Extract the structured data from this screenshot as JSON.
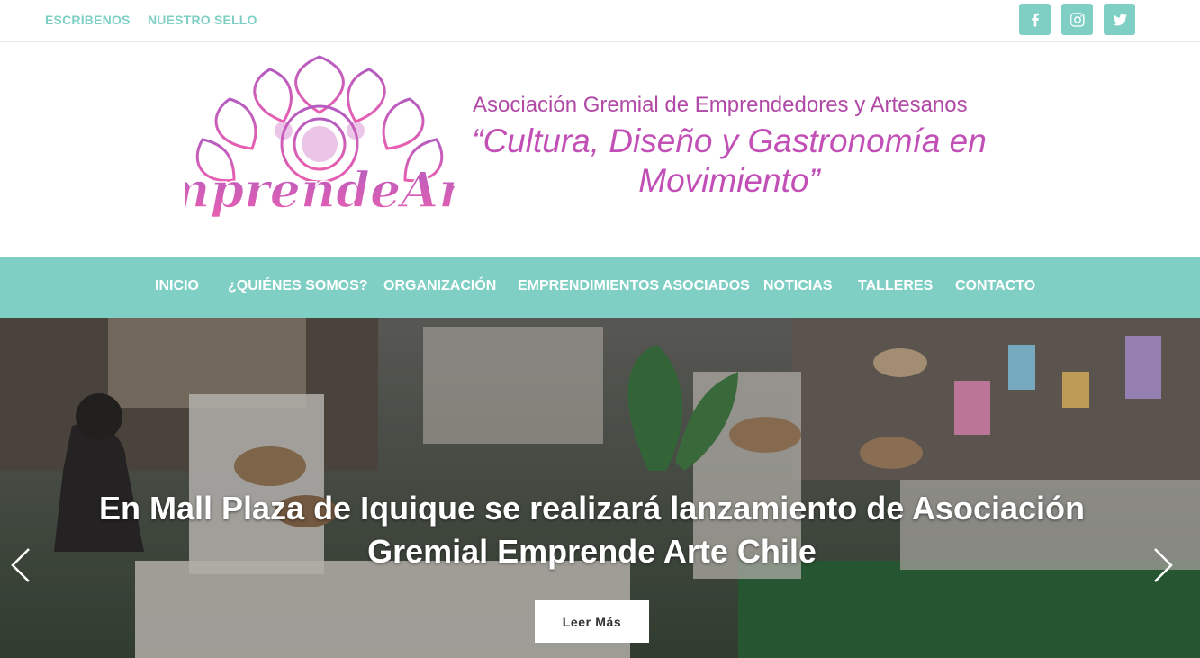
{
  "colors": {
    "accent": "#7fcfc4",
    "brand_magenta": "#c24fb6",
    "social_bg": "#7fcfc4",
    "nav_bg": "#7fcfc4"
  },
  "topbar": {
    "links": [
      "ESCRÍBENOS",
      "NUESTRO SELLO"
    ],
    "social_icons": [
      "facebook-icon",
      "instagram-icon",
      "twitter-icon"
    ]
  },
  "header": {
    "logo_text": "EmprendeArte",
    "tagline_line1": "Asociación Gremial de Emprendedores y Artesanos",
    "tagline_line2": "“Cultura, Diseño y Gastronomía en Movimiento”"
  },
  "nav": {
    "items": [
      "INICIO",
      "¿QUIÉNES SOMOS?",
      "ORGANIZACIÓN",
      "EMPRENDIMIENTOS ASOCIADOS",
      "NOTICIAS",
      "TALLERES",
      "CONTACTO"
    ]
  },
  "hero": {
    "title": "En Mall Plaza de Iquique se realizará lanzamiento de Asociación Gremial Emprende Arte Chile",
    "button_label": "Leer Más",
    "prev_icon": "chevron-left-icon",
    "next_icon": "chevron-right-icon"
  }
}
